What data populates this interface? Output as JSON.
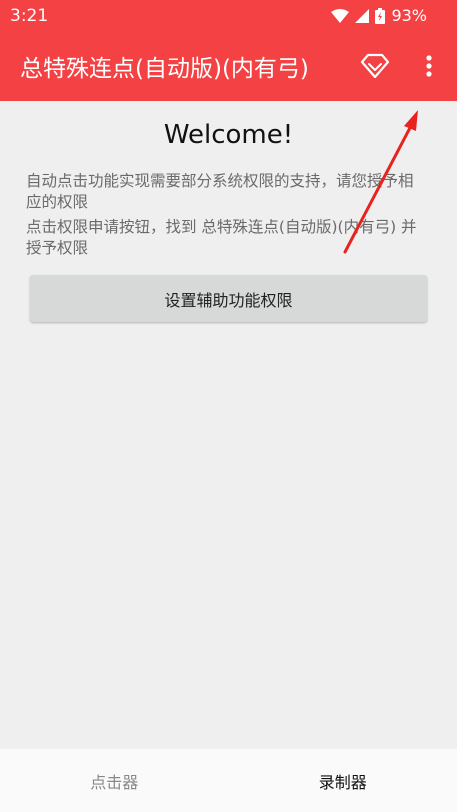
{
  "status": {
    "time": "3:21",
    "battery": "93%"
  },
  "appbar": {
    "title": "总特殊连点(自动版)(内有弓)",
    "diamond_icon": "diamond-icon",
    "menu_icon": "more-vert-icon"
  },
  "main": {
    "welcome": "Welcome!",
    "message1": "自动点击功能实现需要部分系统权限的支持，请您授予相应的权限",
    "message2": "点击权限申请按钮，找到 总特殊连点(自动版)(内有弓) 并授予权限",
    "permission_button": "设置辅助功能权限"
  },
  "bottom_nav": {
    "clicker": "点击器",
    "recorder": "录制器"
  },
  "colors": {
    "accent": "#f44144",
    "annotation_arrow": "#e8231f"
  }
}
